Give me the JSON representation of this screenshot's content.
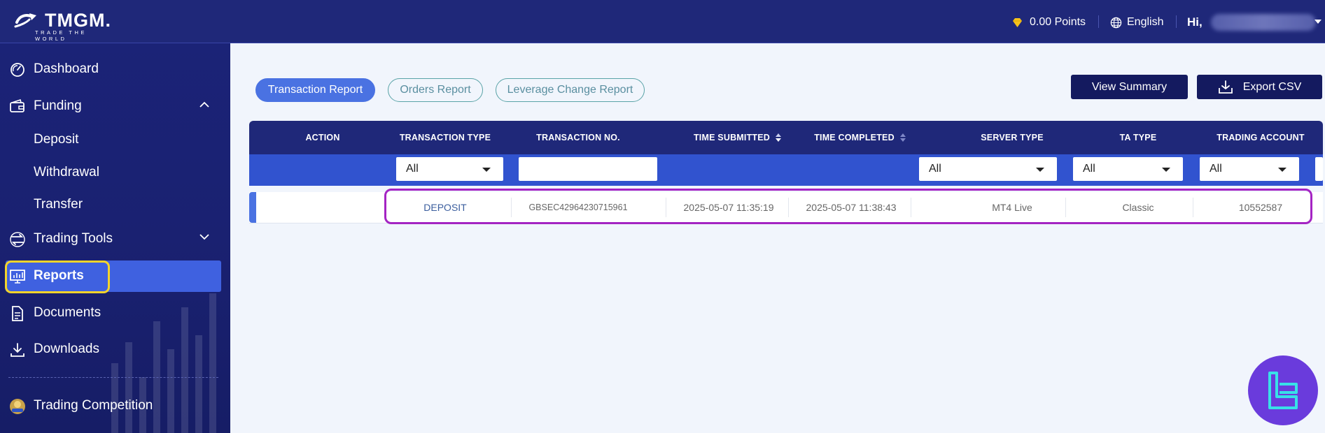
{
  "header": {
    "brand": "TMGM.",
    "tagline": "TRADE THE WORLD",
    "points": "0.00 Points",
    "language": "English",
    "greeting": "Hi,"
  },
  "sidebar": {
    "items": [
      {
        "label": "Dashboard",
        "icon": "speedometer-icon"
      },
      {
        "label": "Funding",
        "icon": "wallet-icon",
        "expanded": true
      },
      {
        "label": "Deposit"
      },
      {
        "label": "Withdrawal"
      },
      {
        "label": "Transfer"
      },
      {
        "label": "Trading Tools",
        "icon": "arrows-exchange-icon",
        "expanded": false
      },
      {
        "label": "Reports",
        "icon": "chart-board-icon",
        "active": true
      },
      {
        "label": "Documents",
        "icon": "document-icon"
      },
      {
        "label": "Downloads",
        "icon": "download-icon"
      },
      {
        "label": "Trading Competition",
        "icon": "trophy-badge-icon"
      }
    ]
  },
  "tabs": {
    "transaction": "Transaction Report",
    "orders": "Orders Report",
    "leverage": "Leverage Change Report"
  },
  "actions": {
    "view_summary": "View Summary",
    "export_csv": "Export CSV"
  },
  "table": {
    "columns": [
      "ACTION",
      "TRANSACTION TYPE",
      "TRANSACTION NO.",
      "TIME SUBMITTED",
      "TIME COMPLETED",
      "SERVER TYPE",
      "TA TYPE",
      "TRADING ACCOUNT"
    ],
    "filters": {
      "transaction_type": "All",
      "transaction_no": "",
      "server_type": "All",
      "ta_type": "All",
      "trading_account": "All"
    },
    "rows": [
      {
        "action": "",
        "transaction_type": "DEPOSIT",
        "transaction_no": "GBSEC42964230715961",
        "time_submitted": "2025-05-07 11:35:19",
        "time_completed": "2025-05-07 11:38:43",
        "server_type": "MT4 Live",
        "ta_type": "Classic",
        "trading_account": "10552587"
      }
    ]
  },
  "colors": {
    "header_bg": "#1f2879",
    "sidebar_active": "#3f61e0",
    "highlight_yellow": "#f4d42a",
    "highlight_purple": "#a424c3",
    "page_bg": "#f1f5fc"
  }
}
